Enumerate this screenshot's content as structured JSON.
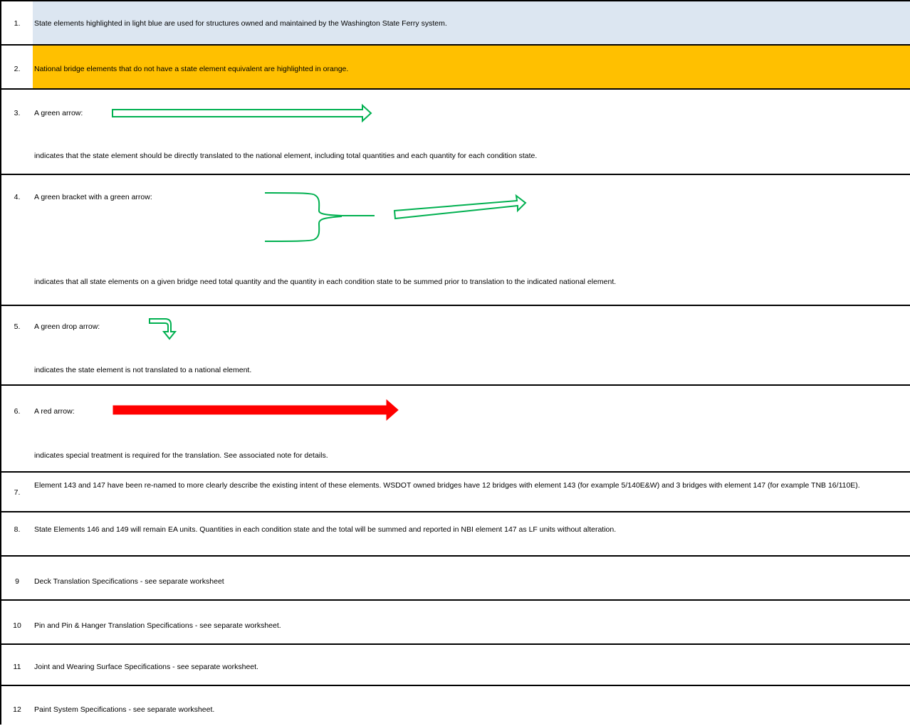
{
  "notes": [
    {
      "num": "1.",
      "text": "State elements highlighted in light blue are used for structures owned and maintained by the Washington State Ferry system.",
      "fill": "#dce6f1"
    },
    {
      "num": "2.",
      "text": "National bridge elements that do not have a state element equivalent are highlighted in orange.",
      "fill": "#ffc000"
    },
    {
      "num": "3.",
      "label": "A green arrow:",
      "text": "indicates that the state element should be directly translated to the national element, including total quantities and each quantity for each condition state.",
      "icon": "green-arrow-icon"
    },
    {
      "num": "4.",
      "label": "A green bracket with a green arrow:",
      "text": "indicates that all state elements on a given bridge need total quantity and the quantity in each condition state to be summed prior to translation to the indicated national element.",
      "icon": "green-bracket-arrow-icon"
    },
    {
      "num": "5.",
      "label": "A green drop arrow:",
      "text": "indicates the state element is not translated to a national element.",
      "icon": "green-drop-arrow-icon"
    },
    {
      "num": "6.",
      "label": "A red arrow:",
      "text": "indicates special treatment is required for the translation.  See associated note for details.",
      "icon": "red-arrow-icon"
    },
    {
      "num": "7.",
      "text": "Element 143 and 147 have been re-named to more clearly describe the existing intent of these elements.  WSDOT owned bridges have 12 bridges with element 143 (for example 5/140E&W) and 3 bridges with element 147 (for example TNB 16/110E)."
    },
    {
      "num": "8.",
      "text": "State Elements 146 and 149 will remain EA units.  Quantities in each condition state and the total will be summed and reported in NBI element 147 as LF units without alteration."
    },
    {
      "num": "9",
      "text": "Deck Translation Specifications - see separate worksheet"
    },
    {
      "num": "10",
      "text": "Pin and Pin & Hanger Translation Specifications - see separate worksheet."
    },
    {
      "num": "11",
      "text": "Joint and Wearing Surface Specifications - see separate worksheet."
    },
    {
      "num": "12",
      "text": "Paint System Specifications - see separate worksheet."
    }
  ],
  "colors": {
    "green": "#00b050",
    "red": "#ff0000",
    "blue_fill": "#dce6f1",
    "orange_fill": "#ffc000"
  }
}
